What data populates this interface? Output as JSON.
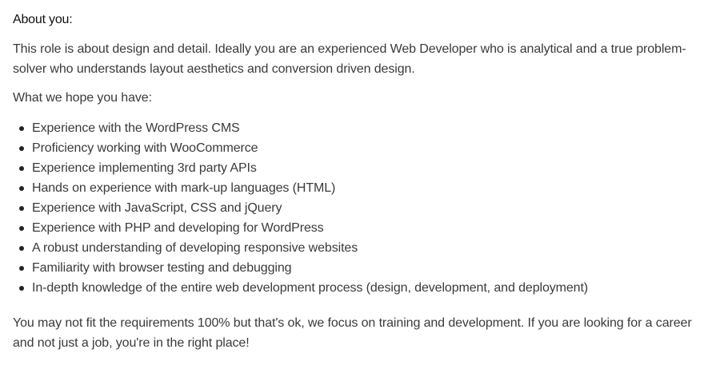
{
  "section": {
    "heading": "About you:",
    "intro": "This role is about design and detail.  Ideally you are an experienced Web Developer who is analytical and a true problem-solver who understands layout aesthetics and conversion driven design.",
    "subheading": "What we hope you have:",
    "requirements": [
      "Experience with the WordPress CMS",
      "Proficiency working with WooCommerce",
      "Experience implementing 3rd party APIs",
      "Hands on experience with mark-up languages (HTML)",
      "Experience with JavaScript, CSS and jQuery",
      "Experience with PHP and developing for WordPress",
      "A robust understanding of developing responsive websites",
      "Familiarity with browser testing and debugging",
      "In-depth knowledge of the entire web development process (design, development, and deployment)"
    ],
    "closing": "You may not fit the requirements 100% but that's ok, we focus on training and development.  If you are looking for a career and not just a job, you're in the right place!"
  }
}
